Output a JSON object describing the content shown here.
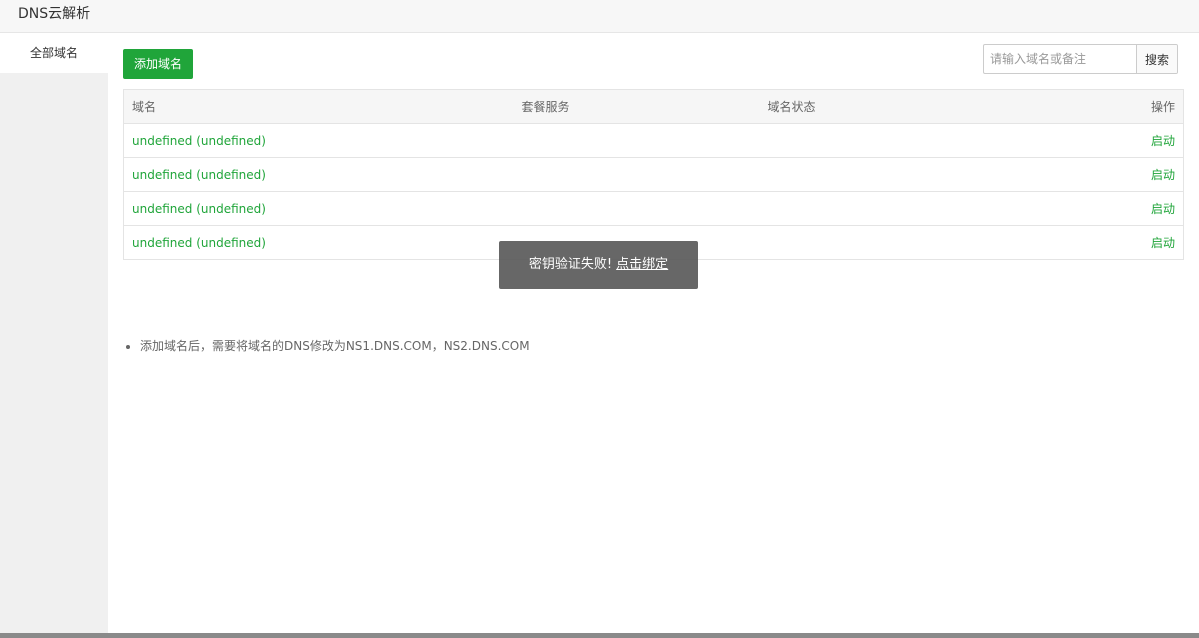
{
  "window": {
    "title": "DNS云解析"
  },
  "sidebar": {
    "items": [
      {
        "label": "全部域名"
      }
    ]
  },
  "toolbar": {
    "add_label": "添加域名",
    "search_placeholder": "请输入域名或备注",
    "search_label": "搜索"
  },
  "table": {
    "headers": {
      "domain": "域名",
      "plan": "套餐服务",
      "status": "域名状态",
      "op": "操作"
    },
    "rows": [
      {
        "domain": "undefined (undefined)",
        "plan": "",
        "status": "",
        "op": "启动"
      },
      {
        "domain": "undefined (undefined)",
        "plan": "",
        "status": "",
        "op": "启动"
      },
      {
        "domain": "undefined (undefined)",
        "plan": "",
        "status": "",
        "op": "启动"
      },
      {
        "domain": "undefined (undefined)",
        "plan": "",
        "status": "",
        "op": "启动"
      }
    ]
  },
  "toast": {
    "message": "密钥验证失败!",
    "link_label": "点击绑定"
  },
  "tips": [
    "添加域名后，需要将域名的DNS修改为NS1.DNS.COM，NS2.DNS.COM"
  ],
  "colors": {
    "accent": "#20a53a",
    "sidebar_bg": "#f0f0f0",
    "toast_bg": "#5a5a5a"
  }
}
